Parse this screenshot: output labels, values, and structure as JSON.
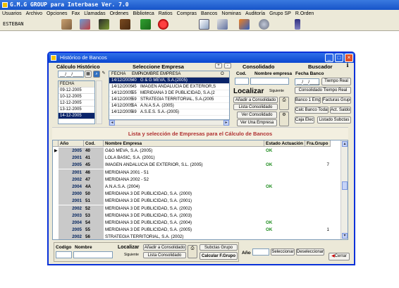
{
  "app": {
    "title": "G.M.G GROUP para Interbase Ver. 7.0"
  },
  "menu": [
    "Usuarios",
    "Archivo",
    "Opciones",
    "Fax",
    "Llamadas",
    "Ordenes",
    "Biblioteca",
    "Ratios",
    "Compras",
    "Bancos",
    "Nominas",
    "Auditoría",
    "Grupo SP",
    "R.Orden"
  ],
  "user": "ESTEBAN",
  "toolbar_icons": [
    "handshake-icon",
    "calculator-icon",
    "chart-icon",
    "books-icon",
    "house-icon",
    "record-icon",
    "document-icon",
    "gear-doc-icon",
    "puzzle-icon",
    "globe-icon",
    "person-icon"
  ],
  "dialog": {
    "title": "Histórico de Bancos",
    "calc_hist": {
      "heading": "Cálculo Histórico",
      "date_value": "__/__/____",
      "col_header": "FECHA",
      "dates": [
        "09-12-2005",
        "10-12-2005",
        "12-12-2005",
        "13-12-2005",
        "14-12-2005"
      ]
    },
    "select_company": {
      "heading": "Seleccione Empresa",
      "headers": {
        "fecha": "FECHA",
        "emp": "EMP",
        "nombre": "NOMBRE EMPRESA",
        "o": "O"
      },
      "rows": [
        {
          "fecha": "14/12/2005",
          "emp": "40",
          "nombre": "G & G MEVA, S.A.(2005)"
        },
        {
          "fecha": "14/12/2005",
          "emp": "45",
          "nombre": "IMAGEN ANDALUCIA DE EXTERIOR,S"
        },
        {
          "fecha": "14/12/2005",
          "emp": "55",
          "nombre": "MERIDIANA 3 DE PUBLICIDAD, S.A.(2"
        },
        {
          "fecha": "14/12/2005",
          "emp": "59",
          "nombre": "STRATEGIA TERRITORIAL, S.A.(2005"
        },
        {
          "fecha": "14/12/2005",
          "emp": "5A",
          "nombre": "A.N.A.S.A. (2005)"
        },
        {
          "fecha": "14/12/2005",
          "emp": "69",
          "nombre": "A.S.E.S. S.A.-(2005)"
        }
      ]
    },
    "consolidado": {
      "heading": "Consolidado",
      "cod_label": "Cod.",
      "nombre_label": "Nombre empresa",
      "localizar": "Localizar",
      "siguiente": "Siguiente",
      "anadir": "Añadir a Consolidado",
      "lista": "Lista Consolidado",
      "ver_consolidado": "Ver Consolidado",
      "ver_empresa": "Ver Una Empresa"
    },
    "buscador": {
      "heading": "Buscador",
      "fecha_banco": "Fecha Banco",
      "date_value": "__/__/____",
      "tiempo_real": "Tiempo Real",
      "consolidado_tiempo_real": "Consolidado Tiempo Real",
      "banco_emp": "Banco 1 Emp.",
      "facturas_grupo": "Facturas Grupo",
      "calc_banco_todas": "Calc Banco Todas",
      "act_saldos": "Act. Saldos",
      "caja_elect": "Caja Elect.",
      "listado_subctas": "Listado Subctas"
    },
    "band_title": "Lista y selección de Empresas para el Cálculo de Bancos",
    "table": {
      "headers": {
        "ano": "Año",
        "cod": "Cod.",
        "empresa": "Nombre Empresa",
        "estado": "Estado Actuación",
        "fra": "Fra.Grupo"
      },
      "rows": [
        {
          "ano": "2005",
          "cod": "40",
          "empresa": "G&G MEVA, S.A. (2005)",
          "estado": "OK",
          "fra": "",
          "selected": true
        },
        {
          "ano": "2001",
          "cod": "41",
          "empresa": "LOLA BASIC, S.A. (2001)",
          "estado": "",
          "fra": ""
        },
        {
          "ano": "2005",
          "cod": "45",
          "empresa": "IMAGEN ANDALUCIA DE EXTERIOR, S.L. (2005)",
          "estado": "OK",
          "fra": "7"
        },
        {
          "ano": "2001",
          "cod": "46",
          "empresa": "MERIDIANA 2001 - 51",
          "estado": "",
          "fra": ""
        },
        {
          "ano": "2002",
          "cod": "47",
          "empresa": "MERIDIANA 2002 - 52",
          "estado": "",
          "fra": ""
        },
        {
          "ano": "2004",
          "cod": "4A",
          "empresa": "A.N.A.S.A. (2004)",
          "estado": "OK",
          "fra": ""
        },
        {
          "ano": "2000",
          "cod": "50",
          "empresa": "MERIDIANA 3 DE PUBLICIDAD, S.A. (2000)",
          "estado": "",
          "fra": ""
        },
        {
          "ano": "2001",
          "cod": "51",
          "empresa": "MERIDIANA 3 DE PUBLICIDAD, S.A. (2001)",
          "estado": "",
          "fra": ""
        },
        {
          "ano": "2002",
          "cod": "52",
          "empresa": "MERIDIANA 3 DE PUBLICIDAD, S.A. (2002)",
          "estado": "",
          "fra": ""
        },
        {
          "ano": "2003",
          "cod": "53",
          "empresa": "MERIDIANA 3 DE PUBLICIDAD, S.A. (2003)",
          "estado": "",
          "fra": ""
        },
        {
          "ano": "2004",
          "cod": "54",
          "empresa": "MERIDIANA 3 DE PUBLICIDAD, S.A. (2004)",
          "estado": "OK",
          "fra": ""
        },
        {
          "ano": "2005",
          "cod": "55",
          "empresa": "MERIDIANA 3 DE PUBLICIDAD, S.A. (2005)",
          "estado": "OK",
          "fra": "1"
        },
        {
          "ano": "2002",
          "cod": "56",
          "empresa": "STRATEGIA TERRITORIAL, S.A. (2002)",
          "estado": "",
          "fra": ""
        }
      ]
    },
    "bottom": {
      "codigo_label": "Codigo",
      "nombre_label": "Nombre",
      "localizar": "Localizar",
      "siguiente": "Siguiente",
      "anadir": "Añadir a Consolidado",
      "lista": "Lista Consolidado",
      "subctas_grupo": "Subctas Grupo",
      "calcular": "Calcular F.Grupo",
      "ano_label": "Año",
      "seleccionar": "Seleccionar",
      "deseleccionar": "Deseleccionar",
      "cerrar": "Cerrar"
    }
  }
}
